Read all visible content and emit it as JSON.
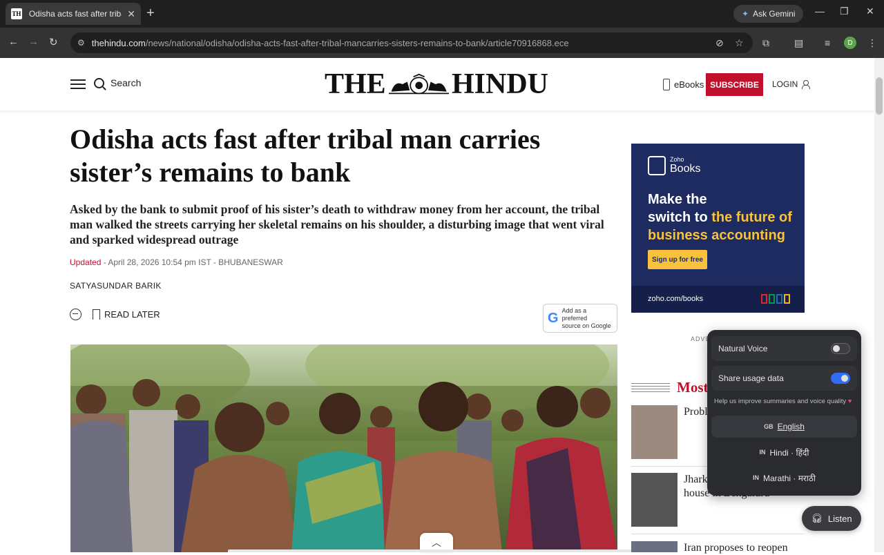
{
  "browser": {
    "tab_title": "Odisha acts fast after tribal man carries",
    "tab_favicon": "TH",
    "ask_gemini": "Ask Gemini",
    "url_host": "thehindu.com",
    "url_path": "/news/national/odisha/odisha-acts-fast-after-tribal-mancarries-sisters-remains-to-bank/article70916868.ece",
    "profile_initial": "D"
  },
  "header": {
    "search_label": "Search",
    "logo_left": "THE",
    "logo_right": "HINDU",
    "ebooks_label": "eBooks",
    "subscribe_label": "SUBSCRIBE",
    "login_label": "LOGIN"
  },
  "article": {
    "headline": "Odisha acts fast after tribal man carries sister’s remains to bank",
    "standfirst": "Asked by the bank to submit proof of his sister’s death to withdraw money from her account, the tribal man walked the streets carrying her skeletal remains on his shoulder, a disturbing image that went viral and sparked widespread outrage",
    "updated_label": "Updated",
    "dateline": " - April 28, 2026 10:54 pm IST - BHUBANESWAR",
    "author": "SATYASUNDAR BARIK",
    "read_later": "READ LATER",
    "google_pref_line1": "Add as a preferred",
    "google_pref_line2": "source on Google"
  },
  "ad": {
    "brand_small": "Zoho",
    "brand_big": "Books",
    "msg_line1": "Make the",
    "msg_line2_plain": "switch to ",
    "msg_line2_hl": "the future of",
    "msg_line3_hl": "business accounting",
    "cta": "Sign up for free",
    "url": "zoho.com/books",
    "label": "ADVE"
  },
  "most_popular": {
    "title": "Most",
    "stories": [
      {
        "text": "Probl trans persis of Bh"
      },
      {
        "text": "Jhark dead in rented house in Bengaluru"
      },
      {
        "text": "Iran proposes to reopen"
      }
    ]
  },
  "listen_panel": {
    "natural_voice_label": "Natural Voice",
    "natural_voice_on": false,
    "share_usage_label": "Share usage data",
    "share_usage_on": true,
    "help_text": "Help us improve summaries and voice quality",
    "languages": [
      {
        "code": "GB",
        "name": "English",
        "selected": true
      },
      {
        "code": "IN",
        "name": "Hindi · हिंदी",
        "selected": false
      },
      {
        "code": "IN",
        "name": "Marathi · मराठी",
        "selected": false
      }
    ],
    "listen_label": "Listen"
  },
  "colors": {
    "brand_red": "#c0102b",
    "toggle_on": "#2f6df6",
    "ad_bg": "#1e2b61",
    "ad_highlight": "#f8c33a"
  },
  "icons": [
    "hamburger-icon",
    "search-icon",
    "ebook-device-icon",
    "user-icon",
    "comment-icon",
    "bookmark-icon",
    "google-g-icon",
    "headphones-icon",
    "chevron-up-icon"
  ]
}
